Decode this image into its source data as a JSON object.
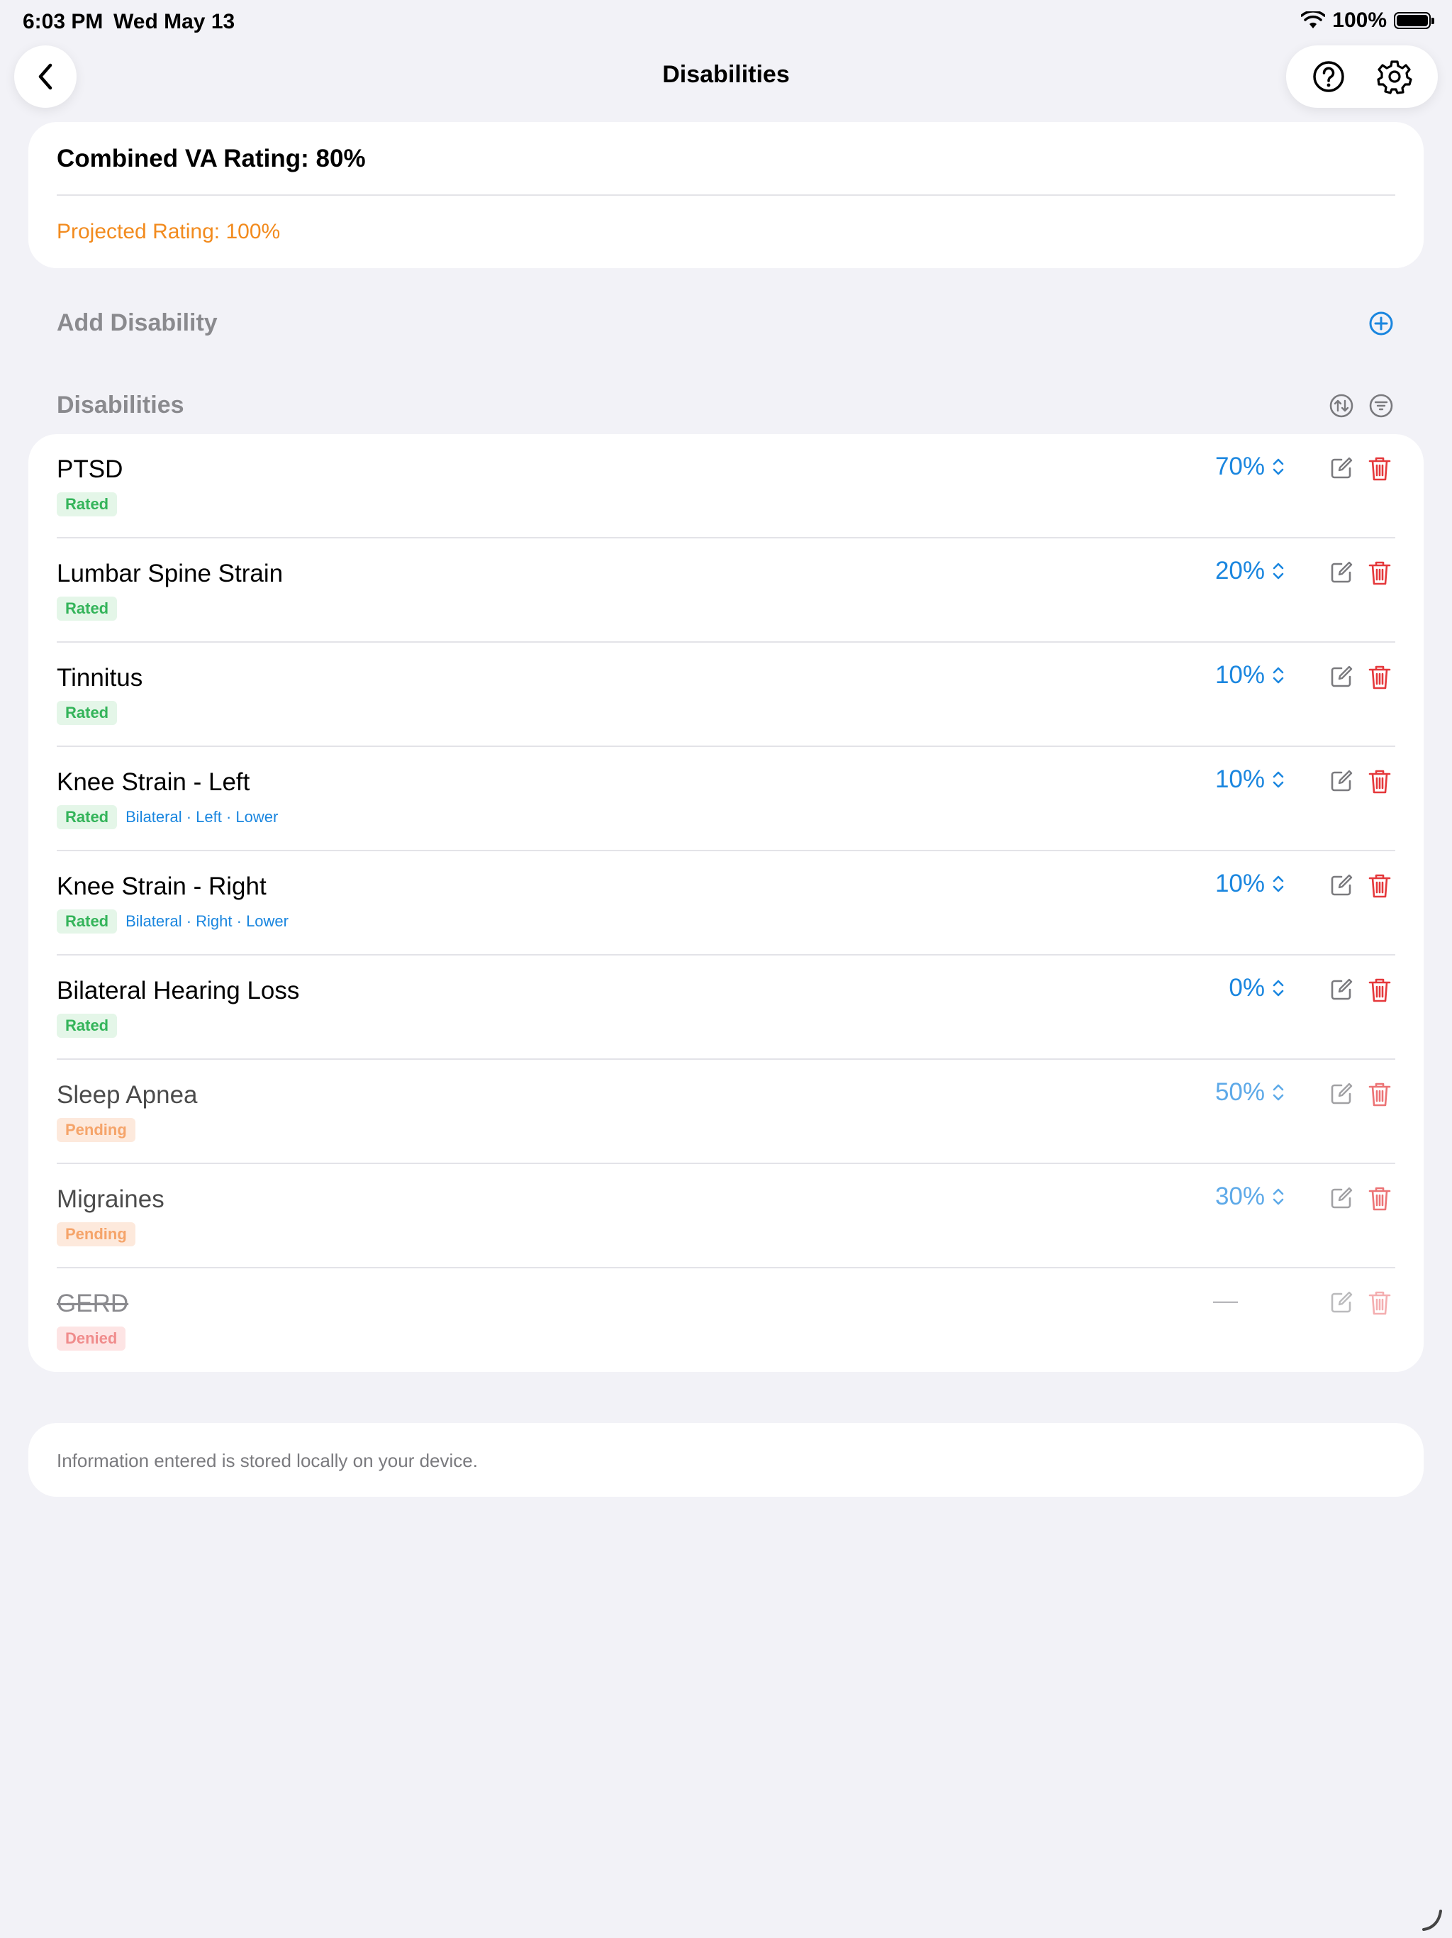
{
  "status_bar": {
    "time": "6:03 PM",
    "date": "Wed May 13",
    "battery": "100%"
  },
  "nav": {
    "title": "Disabilities"
  },
  "summary": {
    "combined": "Combined VA Rating: 80%",
    "projected": "Projected Rating: 100%"
  },
  "sections": {
    "add": "Add Disability",
    "list": "Disabilities"
  },
  "disabilities": [
    {
      "name": "PTSD",
      "status": "Rated",
      "meta": "",
      "rating": "70%"
    },
    {
      "name": "Lumbar Spine Strain",
      "status": "Rated",
      "meta": "",
      "rating": "20%"
    },
    {
      "name": "Tinnitus",
      "status": "Rated",
      "meta": "",
      "rating": "10%"
    },
    {
      "name": "Knee Strain - Left",
      "status": "Rated",
      "meta": "Bilateral · Left · Lower",
      "rating": "10%"
    },
    {
      "name": "Knee Strain - Right",
      "status": "Rated",
      "meta": "Bilateral · Right · Lower",
      "rating": "10%"
    },
    {
      "name": "Bilateral Hearing Loss",
      "status": "Rated",
      "meta": "",
      "rating": "0%"
    },
    {
      "name": "Sleep Apnea",
      "status": "Pending",
      "meta": "",
      "rating": "50%"
    },
    {
      "name": "Migraines",
      "status": "Pending",
      "meta": "",
      "rating": "30%"
    },
    {
      "name": "GERD",
      "status": "Denied",
      "meta": "",
      "rating": "—"
    }
  ],
  "footer": {
    "note": "Information entered is stored locally on your device."
  },
  "colors": {
    "accent": "#1a86df",
    "projected": "#f28b1e",
    "delete": "#e5383b",
    "rated": "#34b45a",
    "pending": "#f5a46a",
    "denied": "#f08c8c"
  }
}
